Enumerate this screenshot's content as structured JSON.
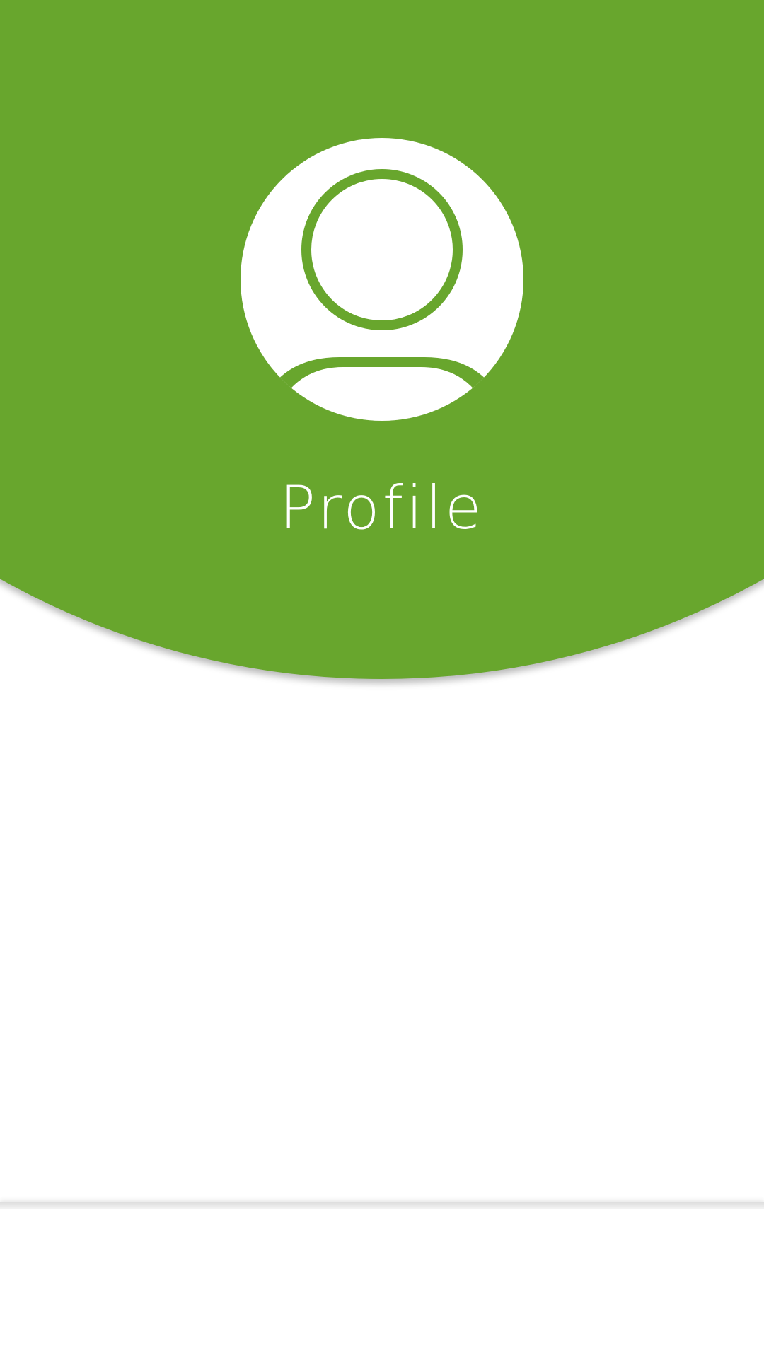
{
  "header": {
    "title": "Profile",
    "accent_color": "#68a62d"
  },
  "avatar": {
    "icon": "user-avatar-icon"
  },
  "bottom_bar": {
    "background": "#ffffff"
  }
}
